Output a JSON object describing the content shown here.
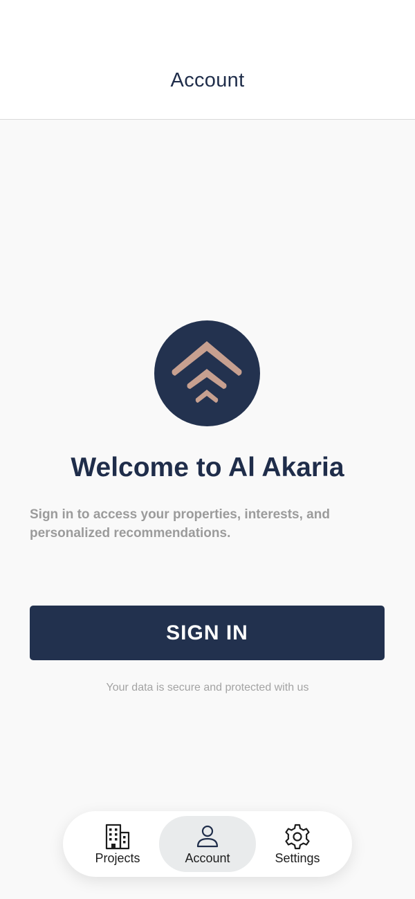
{
  "header": {
    "title": "Account"
  },
  "welcome": {
    "title": "Welcome to Al Akaria",
    "subtitle": "Sign in to access your properties, interests, and personalized recommendations."
  },
  "signin": {
    "label": "SIGN IN"
  },
  "secure_note": "Your data is secure and protected with us",
  "colors": {
    "brand_navy": "#22314e",
    "logo_accent": "#c7a090",
    "background": "#f9f9f9",
    "muted_text": "#9b9b9b"
  },
  "tabbar": {
    "items": [
      {
        "label": "Projects",
        "icon": "building-icon",
        "active": false
      },
      {
        "label": "Account",
        "icon": "person-icon",
        "active": true
      },
      {
        "label": "Settings",
        "icon": "gear-icon",
        "active": false
      }
    ]
  }
}
